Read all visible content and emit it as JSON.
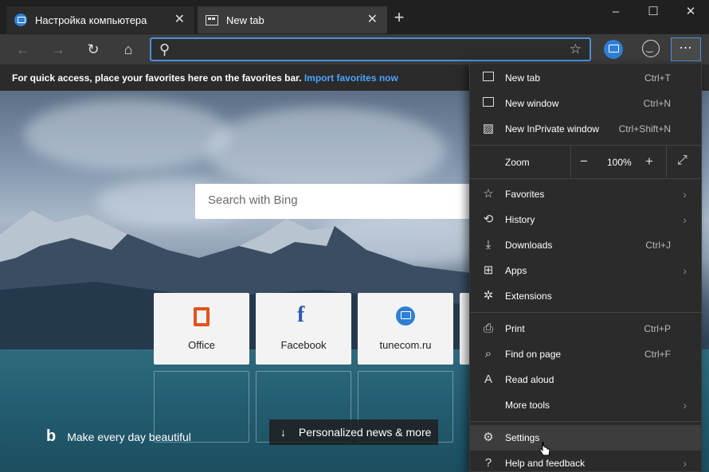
{
  "tabs": [
    {
      "label": "Настройка компьютера"
    },
    {
      "label": "New tab"
    }
  ],
  "favorites_bar": {
    "text": "For quick access, place your favorites here on the favorites bar.",
    "link": "Import favorites now"
  },
  "newtab": {
    "search_placeholder": "Search with Bing",
    "tiles": [
      {
        "label": "Office"
      },
      {
        "label": "Facebook"
      },
      {
        "label": "tunecom.ru"
      }
    ],
    "bing_tagline": "Make every day beautiful",
    "news_button": "Personalized news & more"
  },
  "menu": {
    "items": [
      {
        "label": "New tab",
        "shortcut": "Ctrl+T",
        "icon": "new-tab-icon"
      },
      {
        "label": "New window",
        "shortcut": "Ctrl+N",
        "icon": "window-icon"
      },
      {
        "label": "New InPrivate window",
        "shortcut": "Ctrl+Shift+N",
        "icon": "inprivate-icon"
      },
      {
        "label": "Favorites",
        "icon": "star-icon"
      },
      {
        "label": "History",
        "icon": "history-icon"
      },
      {
        "label": "Downloads",
        "shortcut": "Ctrl+J",
        "icon": "download-icon"
      },
      {
        "label": "Apps",
        "icon": "apps-icon"
      },
      {
        "label": "Extensions",
        "icon": "puzzle-icon"
      },
      {
        "label": "Print",
        "shortcut": "Ctrl+P",
        "icon": "print-icon"
      },
      {
        "label": "Find on page",
        "shortcut": "Ctrl+F",
        "icon": "find-icon"
      },
      {
        "label": "Read aloud",
        "icon": "read-aloud-icon"
      },
      {
        "label": "More tools",
        "icon": "tools-icon"
      },
      {
        "label": "Settings",
        "icon": "gear-icon"
      },
      {
        "label": "Help and feedback",
        "icon": "help-icon"
      }
    ],
    "zoom": {
      "label": "Zoom",
      "value": "100%",
      "minus": "−",
      "plus": "+"
    }
  },
  "colors": {
    "accent": "#4a90d9",
    "link": "#4aa3ff"
  }
}
